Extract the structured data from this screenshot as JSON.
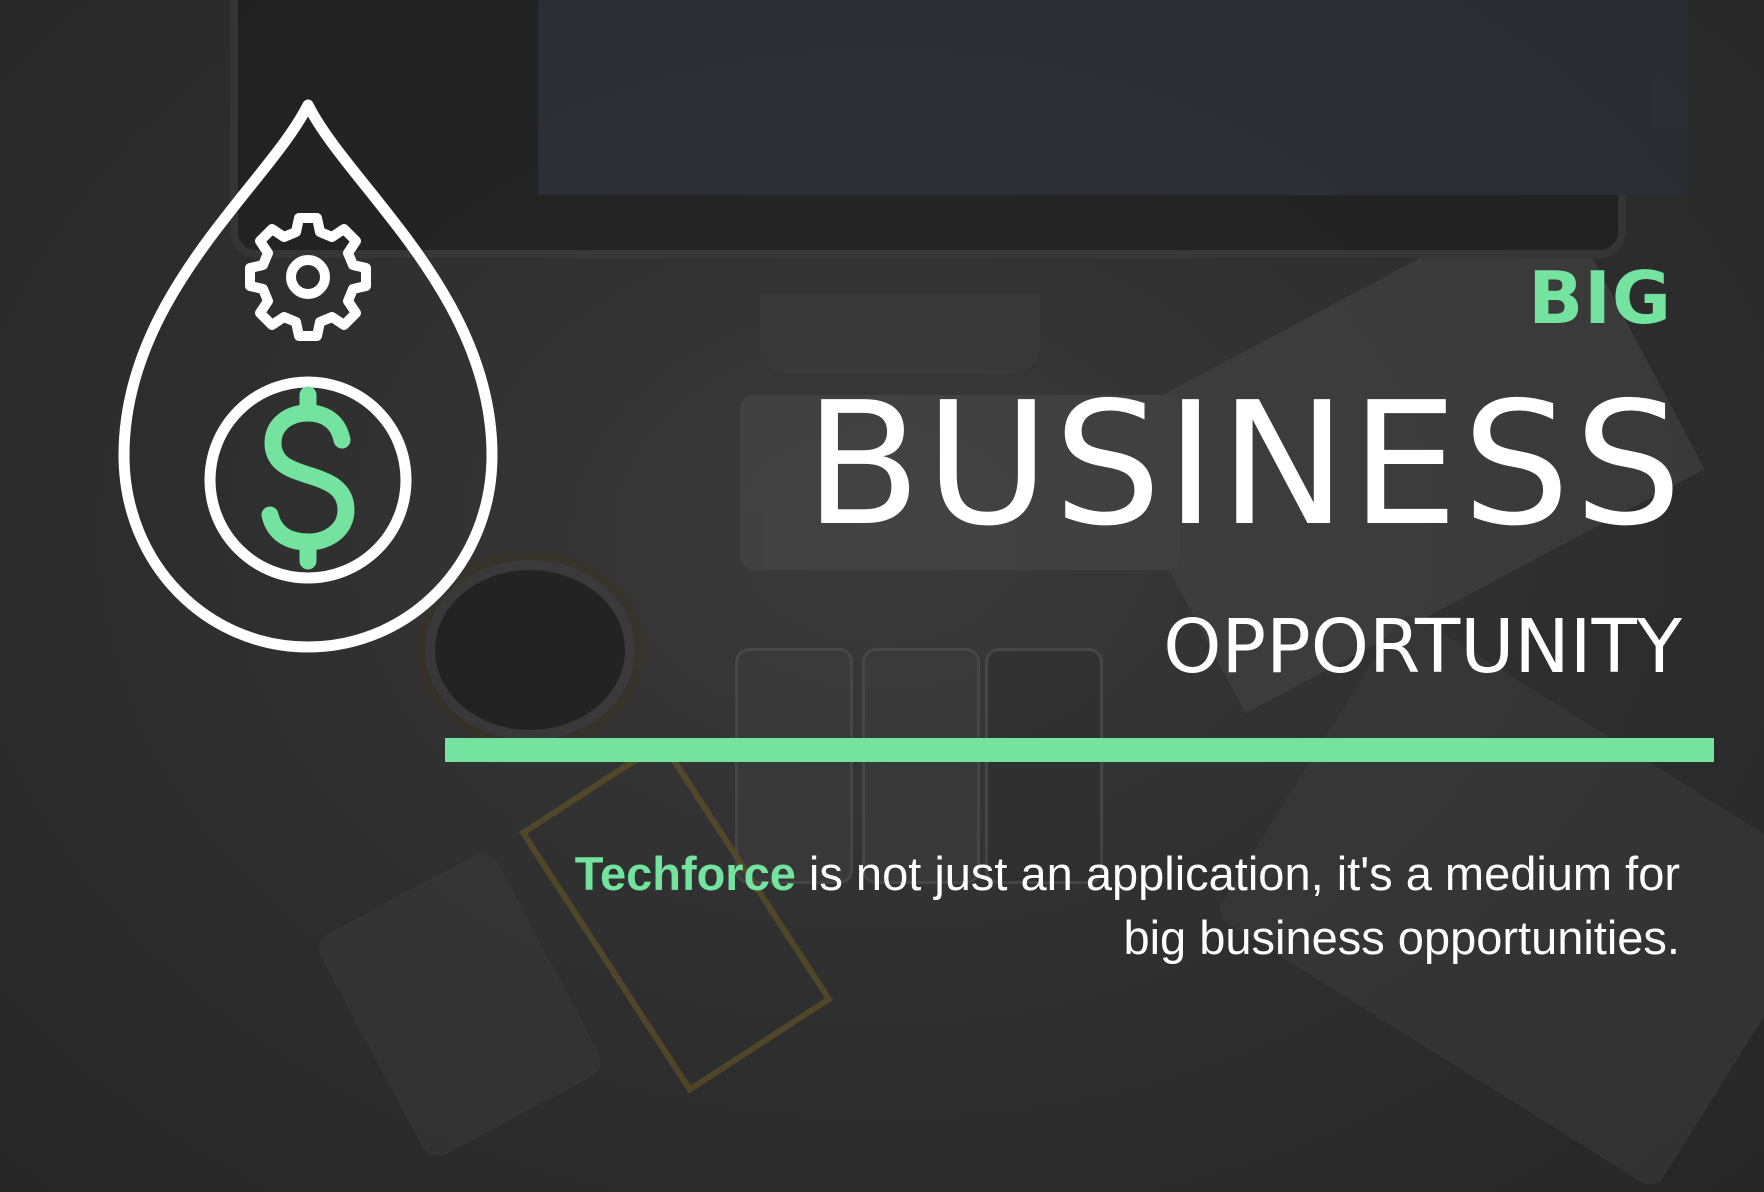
{
  "headline": {
    "big": "BIG",
    "business": "BUSINESS",
    "opportunity": "OPPORTUNITY"
  },
  "tagline": {
    "brand": "Techforce",
    "line1_rest": " is not just an application, it's a medium for",
    "line2": "big business opportunities."
  },
  "icon": {
    "name": "money-drop-icon",
    "outline_color": "#ffffff",
    "dollar_color": "#74e3a0"
  },
  "colors": {
    "accent": "#74e3a0",
    "text": "#ffffff",
    "overlay": "#2b2b2b"
  }
}
